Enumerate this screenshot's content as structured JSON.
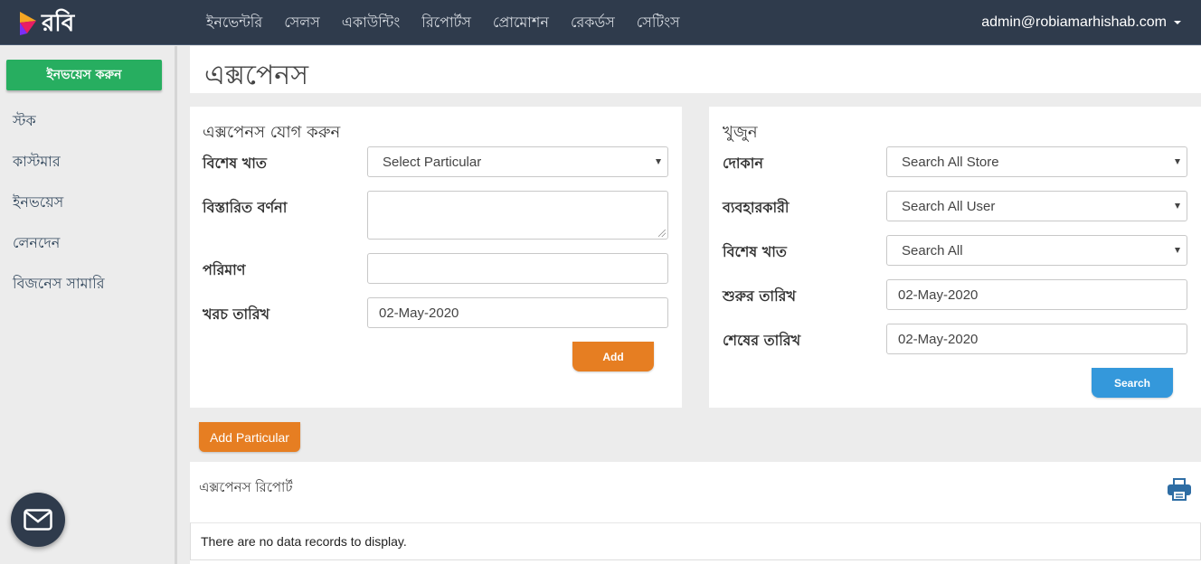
{
  "brand": {
    "logo_text": "রবি"
  },
  "nav": {
    "items": [
      "ইনভেন্টরি",
      "সেলস",
      "একাউন্টিং",
      "রিপোর্টস",
      "প্রোমোশন",
      "রেকর্ডস",
      "সেটিংস"
    ],
    "user_email": "admin@robiamarhishab.com"
  },
  "sidebar": {
    "invoice_button": "ইনভয়েস করুন",
    "links": [
      "স্টক",
      "কাস্টমার",
      "ইনভয়েস",
      "লেনদেন",
      "বিজনেস সামারি"
    ]
  },
  "page": {
    "title": "এক্সপেনস"
  },
  "add_form": {
    "heading": "এক্সপেনস যোগ করুন",
    "particular_label": "বিশেষ খাত",
    "particular_select": "Select Particular",
    "description_label": "বিস্তারিত বর্ণনা",
    "description_value": "",
    "amount_label": "পরিমাণ",
    "amount_value": "",
    "date_label": "খরচ তারিখ",
    "date_value": "02-May-2020",
    "add_button": "Add"
  },
  "search_form": {
    "heading": "খুজুন",
    "store_label": "দোকান",
    "store_select": "Search All Store",
    "user_label": "ব্যবহারকারী",
    "user_select": "Search All User",
    "particular_label": "বিশেষ খাত",
    "particular_select": "Search All",
    "start_label": "শুরুর তারিখ",
    "start_value": "02-May-2020",
    "end_label": "শেষের তারিখ",
    "end_value": "02-May-2020",
    "search_button": "Search"
  },
  "add_particular_button": "Add Particular",
  "report": {
    "title": "এক্সপেনস রিপোর্ট",
    "empty_message": "There are no data records to display."
  },
  "colors": {
    "topbar": "#2f3b4c",
    "green": "#27ae60",
    "orange": "#e67e22",
    "blue": "#3498db",
    "print_icon": "#2e6da4"
  },
  "icons": [
    "robi-logo-icon",
    "caret-down-icon",
    "mail-icon",
    "print-icon"
  ]
}
